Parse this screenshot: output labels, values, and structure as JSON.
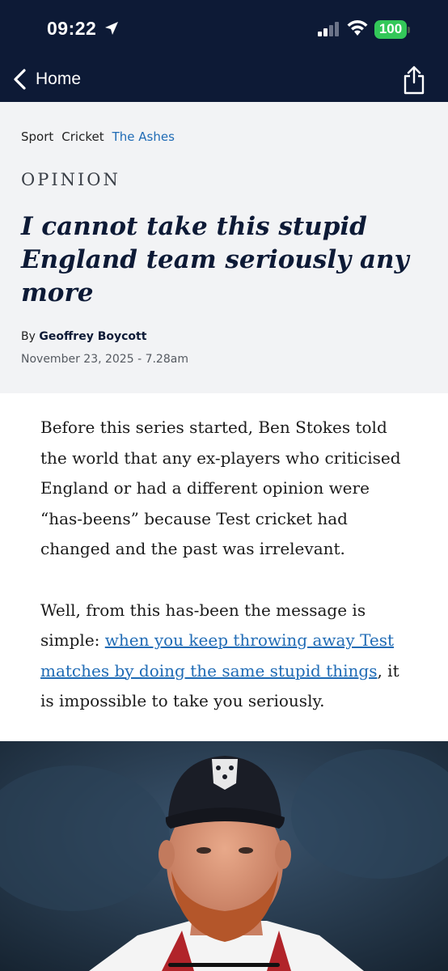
{
  "status_bar": {
    "time": "09:22",
    "battery": "100",
    "battery_color": "#33c759"
  },
  "nav": {
    "back_label": "Home",
    "back_icon": "chevron-left-icon",
    "share_icon": "share-icon"
  },
  "article": {
    "breadcrumbs": [
      {
        "label": "Sport"
      },
      {
        "label": "Cricket"
      },
      {
        "label": "The Ashes"
      }
    ],
    "kicker": "OPINION",
    "headline": "I cannot take this stupid England team seriously any more",
    "byline_prefix": "By",
    "author": "Geoffrey Boycott",
    "date": "November 23, 2025 - 7.28am",
    "paragraphs": [
      {
        "text": "Before this series started, Ben Stokes told the world that any ex-players who criticised England or had a different opinion were “has-beens” because Test cricket had changed and the past was irrelevant."
      },
      {
        "before": "Well, from this has-been the message is simple: ",
        "link": "when you keep throwing away Test matches by doing the same stupid things",
        "after": ", it is impossible to take you seriously."
      }
    ],
    "photo": "cricketer-portrait-photo"
  },
  "colors": {
    "header_bg": "#0d1a36",
    "article_head_bg": "#f2f3f5",
    "link": "#1f6bb5"
  }
}
